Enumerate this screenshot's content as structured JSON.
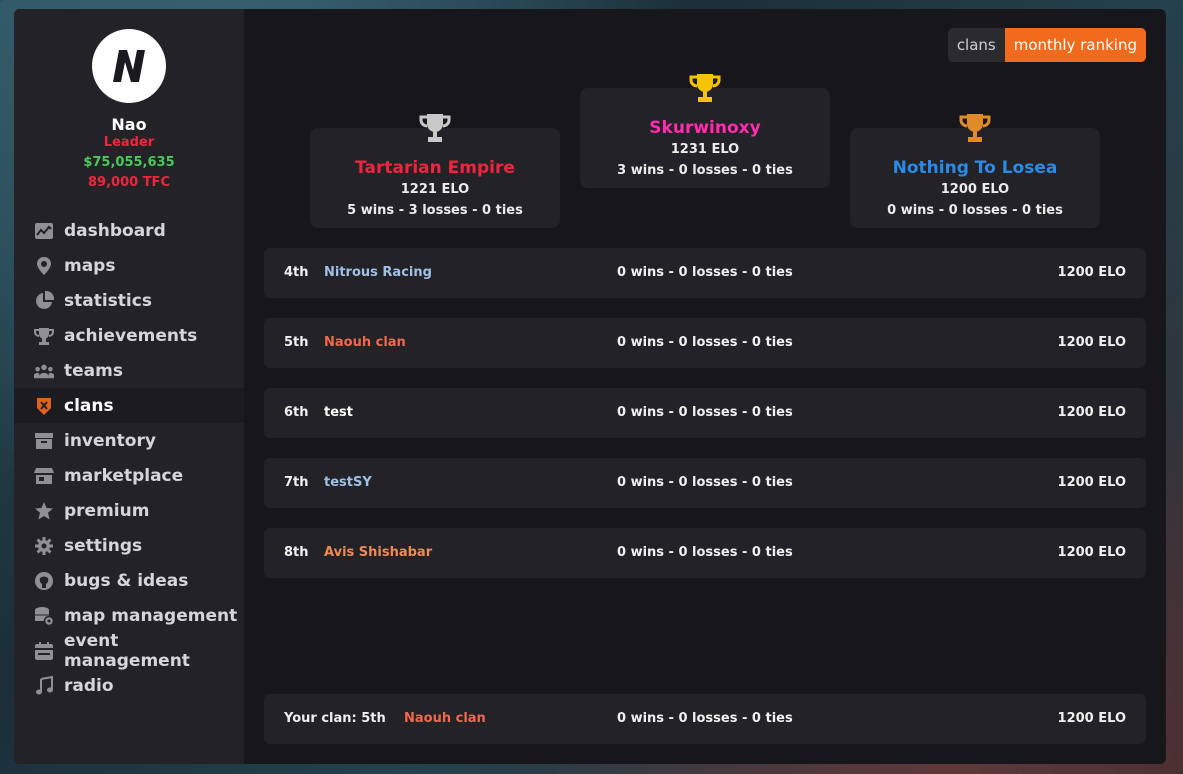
{
  "colors": {
    "accent": "#f26a1b",
    "gold": "#f5c400",
    "silver": "#c9c9c9",
    "bronze": "#e08a28",
    "red": "#f0243e",
    "green": "#4bc95a",
    "pink": "#ff2bb0",
    "blue": "#2a8be8",
    "light_blue": "#9ec1e8",
    "salmon": "#ef6a4d",
    "orange_name": "#f08a53"
  },
  "profile": {
    "name": "Nao",
    "role": "Leader",
    "money": "$75,055,635",
    "tfc": "89,000 TFC",
    "avatar_icon": "n-logo-icon"
  },
  "nav": [
    {
      "label": "dashboard",
      "icon": "chart-icon"
    },
    {
      "label": "maps",
      "icon": "map-pin-icon"
    },
    {
      "label": "statistics",
      "icon": "pie-chart-icon"
    },
    {
      "label": "achievements",
      "icon": "trophy-icon"
    },
    {
      "label": "teams",
      "icon": "users-icon"
    },
    {
      "label": "clans",
      "icon": "clan-shield-icon",
      "active": true
    },
    {
      "label": "inventory",
      "icon": "inventory-box-icon"
    },
    {
      "label": "marketplace",
      "icon": "store-icon"
    },
    {
      "label": "premium",
      "icon": "star-icon"
    },
    {
      "label": "settings",
      "icon": "gear-icon"
    },
    {
      "label": "bugs & ideas",
      "icon": "github-icon"
    },
    {
      "label": "map management",
      "icon": "database-gear-icon"
    },
    {
      "label": "event management",
      "icon": "calendar-icon"
    },
    {
      "label": "radio",
      "icon": "music-note-icon"
    }
  ],
  "tabs": [
    {
      "label": "clans",
      "active": false
    },
    {
      "label": "monthly ranking",
      "active": true
    }
  ],
  "podium": {
    "first": {
      "name": "Skurwinoxy",
      "elo": "1231 ELO",
      "record": "3 wins - 0 losses - 0 ties",
      "color": "#ff2bb0",
      "trophy": "gold-trophy-icon"
    },
    "second": {
      "name": "Tartarian Empire",
      "elo": "1221 ELO",
      "record": "5 wins - 3 losses - 0 ties",
      "color": "#f0243e",
      "trophy": "silver-trophy-icon"
    },
    "third": {
      "name": "Nothing To Losea",
      "elo": "1200 ELO",
      "record": "0 wins - 0 losses - 0 ties",
      "color": "#2a8be8",
      "trophy": "bronze-trophy-icon"
    }
  },
  "rankings": [
    {
      "rank": "4th",
      "name": "Nitrous Racing",
      "record": "0 wins - 0 losses - 0 ties",
      "elo": "1200 ELO",
      "color": "#9ec1e8"
    },
    {
      "rank": "5th",
      "name": "Naouh clan",
      "record": "0 wins - 0 losses - 0 ties",
      "elo": "1200 ELO",
      "color": "#ef6a4d"
    },
    {
      "rank": "6th",
      "name": "test",
      "record": "0 wins - 0 losses - 0 ties",
      "elo": "1200 ELO",
      "color": "#ffffff"
    },
    {
      "rank": "7th",
      "name": "testSY",
      "record": "0 wins - 0 losses - 0 ties",
      "elo": "1200 ELO",
      "color": "#9ec1e8"
    },
    {
      "rank": "8th",
      "name": "Avis Shishabar",
      "record": "0 wins - 0 losses - 0 ties",
      "elo": "1200 ELO",
      "color": "#f08a53"
    }
  ],
  "your_clan": {
    "label": "Your clan: 5th",
    "name": "Naouh clan",
    "record": "0 wins - 0 losses - 0 ties",
    "elo": "1200 ELO",
    "color": "#ef6a4d"
  }
}
